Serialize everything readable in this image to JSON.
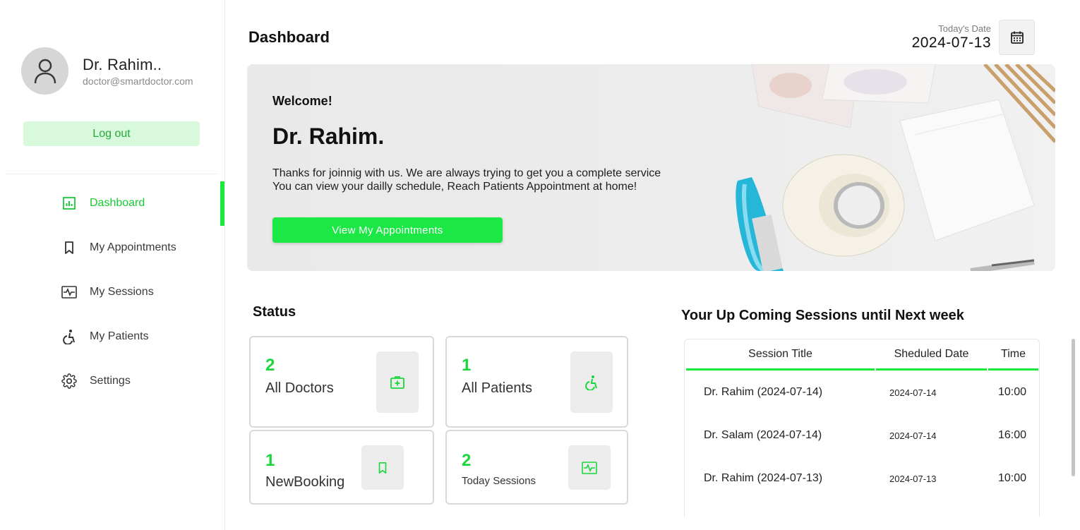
{
  "sidebar": {
    "user_name": "Dr. Rahim..",
    "user_email": "doctor@smartdoctor.com",
    "logout_label": "Log out",
    "menu": [
      {
        "label": "Dashboard",
        "icon": "bar-chart-icon",
        "active": true
      },
      {
        "label": "My Appointments",
        "icon": "bookmark-icon",
        "active": false
      },
      {
        "label": "My Sessions",
        "icon": "pulse-icon",
        "active": false
      },
      {
        "label": "My Patients",
        "icon": "accessible-icon",
        "active": false
      },
      {
        "label": "Settings",
        "icon": "gear-icon",
        "active": false
      }
    ]
  },
  "header": {
    "title": "Dashboard",
    "date_label": "Today's Date",
    "date_value": "2024-07-13"
  },
  "banner": {
    "welcome": "Welcome!",
    "name": "Dr. Rahim.",
    "line1": "Thanks for joinnig with us. We are always trying to get you a complete service",
    "line2": "You can view your dailly schedule, Reach Patients Appointment at home!",
    "button_label": "View My Appointments"
  },
  "status": {
    "title": "Status",
    "cards": [
      {
        "count": "2",
        "label": "All Doctors",
        "icon": "medical-bag-icon"
      },
      {
        "count": "1",
        "label": "All Patients",
        "icon": "accessible-icon"
      },
      {
        "count": "1",
        "label": "NewBooking",
        "icon": "bookmark-icon"
      },
      {
        "count": "2",
        "label": "Today Sessions",
        "icon": "pulse-icon"
      }
    ]
  },
  "sessions": {
    "title": "Your Up Coming Sessions until Next week",
    "columns": [
      "Session Title",
      "Sheduled Date",
      "Time"
    ],
    "rows": [
      {
        "title": "Dr. Rahim (2024-07-14)",
        "date": "2024-07-14",
        "time": "10:00"
      },
      {
        "title": "Dr. Salam (2024-07-14)",
        "date": "2024-07-14",
        "time": "16:00"
      },
      {
        "title": "Dr. Rahim (2024-07-13)",
        "date": "2024-07-13",
        "time": "10:00"
      }
    ]
  },
  "colors": {
    "accent": "#19e83e",
    "accent_text": "#19d63c",
    "logout_bg": "#d8f9dc"
  }
}
